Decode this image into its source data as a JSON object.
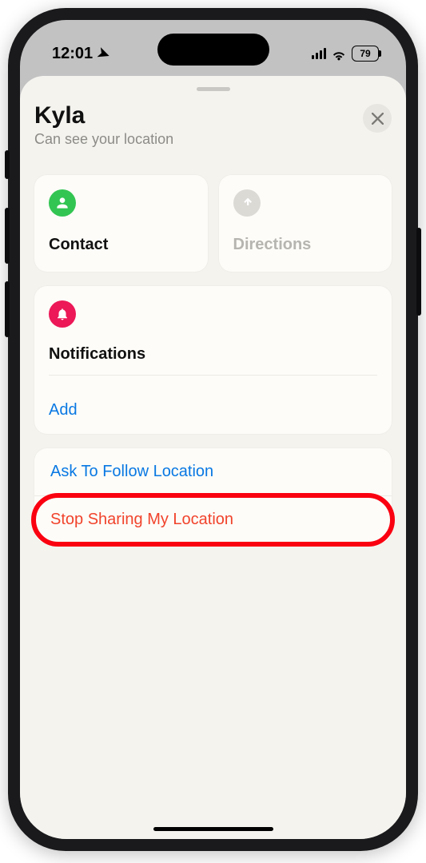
{
  "status_bar": {
    "time": "12:01",
    "battery": "79"
  },
  "sheet": {
    "title": "Kyla",
    "subtitle": "Can see your location"
  },
  "cards": {
    "contact": "Contact",
    "directions": "Directions"
  },
  "notifications": {
    "title": "Notifications",
    "add": "Add"
  },
  "actions": {
    "ask": "Ask To Follow Location",
    "stop": "Stop Sharing My Location"
  }
}
